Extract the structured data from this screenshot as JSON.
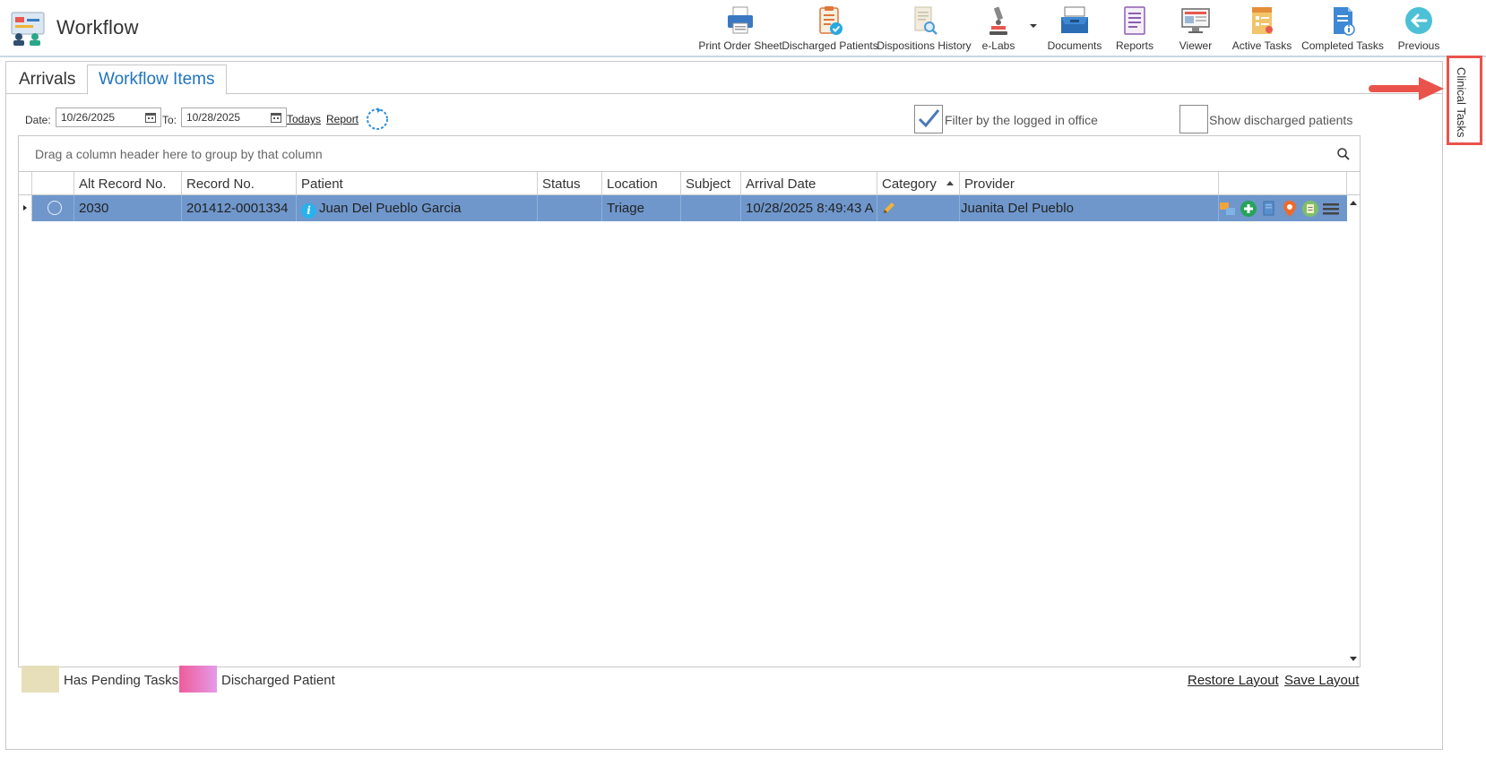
{
  "app": {
    "title": "Workflow"
  },
  "toolbar": {
    "print_order_sheet": "Print Order Sheet",
    "discharged_patients": "Discharged Patients",
    "dispositions_history": "Dispositions History",
    "elabs": "e-Labs",
    "documents": "Documents",
    "reports": "Reports",
    "viewer": "Viewer",
    "active_tasks": "Active Tasks",
    "completed_tasks": "Completed Tasks",
    "previous": "Previous"
  },
  "tabs": {
    "arrivals": "Arrivals",
    "workflow_items": "Workflow Items"
  },
  "filters": {
    "date_label": "Date:",
    "date_from": "10/26/2025",
    "to_label": "To:",
    "date_to": "10/28/2025",
    "todays_link": "Todays",
    "report_link": "Report",
    "filter_office_label": "Filter by the logged in office",
    "filter_office_checked": true,
    "show_discharged_label": "Show discharged patients",
    "show_discharged_checked": false
  },
  "grid": {
    "group_panel_text": "Drag a column header here to group by that column",
    "columns": {
      "alt_record": "Alt Record No.",
      "record": "Record No.",
      "patient": "Patient",
      "status": "Status",
      "location": "Location",
      "subject": "Subject",
      "arrival_date": "Arrival Date",
      "category": "Category",
      "provider": "Provider"
    },
    "rows": [
      {
        "alt_record": "2030",
        "record": "201412-0001334",
        "patient": "Juan Del Pueblo Garcia",
        "status": "",
        "location": "Triage",
        "subject": "",
        "arrival_date": "10/28/2025 8:49:43 A",
        "provider": "Juanita Del Pueblo"
      }
    ]
  },
  "legend": {
    "pending_label": "Has Pending Tasks",
    "discharged_label": "Discharged Patient",
    "pending_color": "#e6dfb9",
    "discharged_color": "#ee5c9a"
  },
  "layout": {
    "restore": "Restore Layout",
    "save": "Save Layout"
  },
  "side_panel": {
    "label": "Clinical Tasks"
  },
  "colors": {
    "selected_row": "#6f97cc",
    "accent": "#1f74c2",
    "callout": "#e9534b"
  }
}
